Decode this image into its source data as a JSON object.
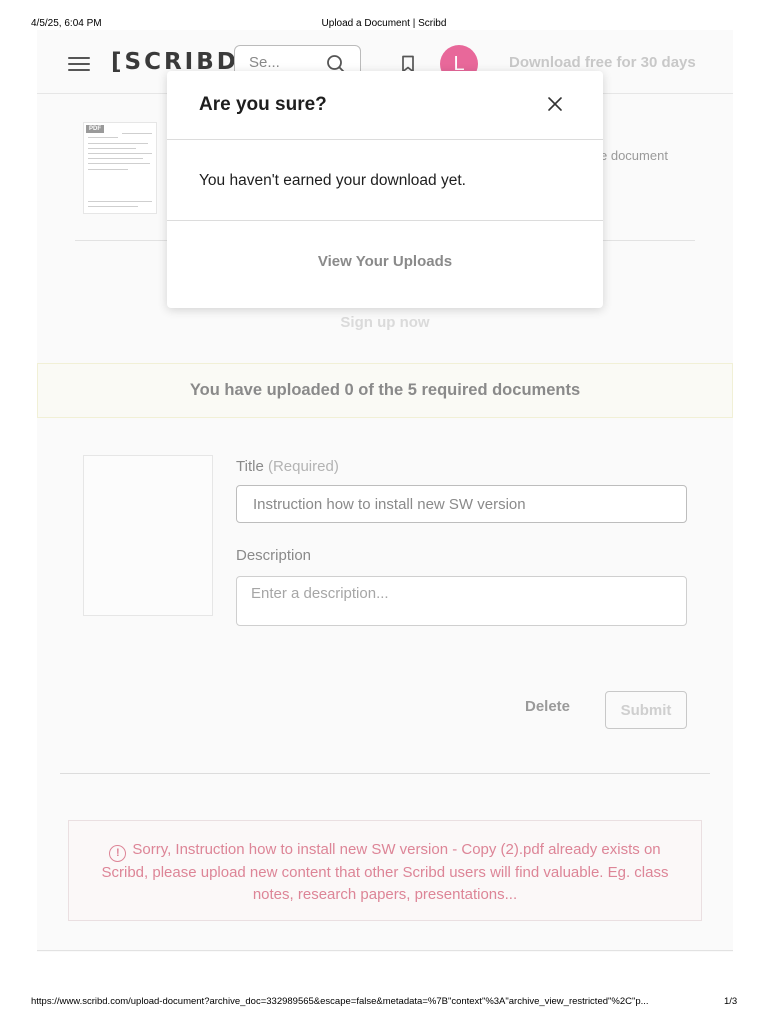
{
  "print_header": {
    "date": "4/5/25, 6:04 PM",
    "title": "Upload a Document | Scribd"
  },
  "nav": {
    "logo": "[SCRIBD]",
    "search_placeholder": "Se...",
    "avatar_initial": "L",
    "cta": "Download free for 30 days",
    "avatar_color": "#e8689a"
  },
  "background": {
    "thumb_tag": "PDF",
    "note_fragment": "e document",
    "signup_link": "Sign up now",
    "progress_banner": "You have uploaded 0 of the 5 required documents"
  },
  "form": {
    "title_label": "Title",
    "title_required": "(Required)",
    "title_value": "Instruction how to install new SW version",
    "description_label": "Description",
    "description_placeholder": "Enter a description...",
    "delete_label": "Delete",
    "submit_label": "Submit"
  },
  "error": {
    "icon": "alert-circle-icon",
    "message": "Sorry, Instruction how to install new SW version - Copy (2).pdf already exists on Scribd, please upload new content that other Scribd users will find valuable. Eg. class notes, research papers, presentations...",
    "color": "#dd8597"
  },
  "modal": {
    "title": "Are you sure?",
    "message": "You haven't earned your download yet.",
    "action": "View Your Uploads"
  },
  "print_footer": {
    "url": "https://www.scribd.com/upload-document?archive_doc=332989565&escape=false&metadata=%7B\"context\"%3A\"archive_view_restricted\"%2C\"p...",
    "page": "1/3"
  }
}
